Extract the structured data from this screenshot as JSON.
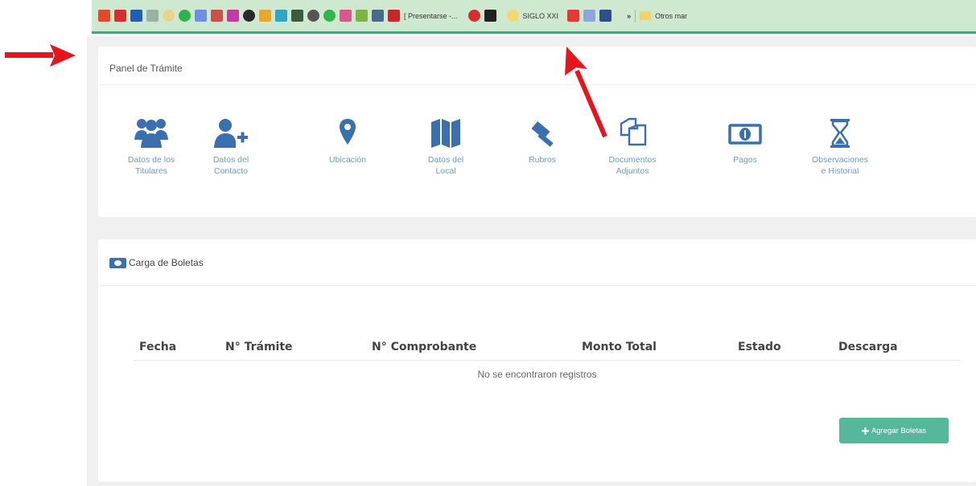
{
  "bookmarks": {
    "tab_label": "[ Presentarse -...",
    "siglo_label": "SIGLO XXI",
    "overflow": "»",
    "other_label": "Otros mar"
  },
  "panel_tramite": {
    "title": "Panel de Trámite",
    "items": [
      {
        "label": "Datos de los\nTitulares",
        "icon": "users-icon"
      },
      {
        "label": "Datos del\nContacto",
        "icon": "user-plus-icon"
      },
      {
        "label": "Ubicación",
        "icon": "map-marker-icon"
      },
      {
        "label": "Datos del\nLocal",
        "icon": "map-icon"
      },
      {
        "label": "Rubros",
        "icon": "gavel-icon"
      },
      {
        "label": "Documentos\nAdjuntos",
        "icon": "files-icon"
      },
      {
        "label": "Pagos",
        "icon": "money-icon"
      },
      {
        "label": "Observaciones\ne Historial",
        "icon": "hourglass-icon"
      }
    ]
  },
  "boletas": {
    "title": "Carga de Boletas",
    "columns": [
      "Fecha",
      "N° Trámite",
      "N° Comprobante",
      "Monto Total",
      "Estado",
      "Descarga"
    ],
    "empty_message": "No se encontraron registros",
    "add_button": "Agregar Boletas"
  },
  "colors": {
    "icon_blue": "#3a6fb0",
    "label_blue": "#6f9bc4",
    "button_green": "#55b89a",
    "annotation_red": "#e8141b"
  }
}
